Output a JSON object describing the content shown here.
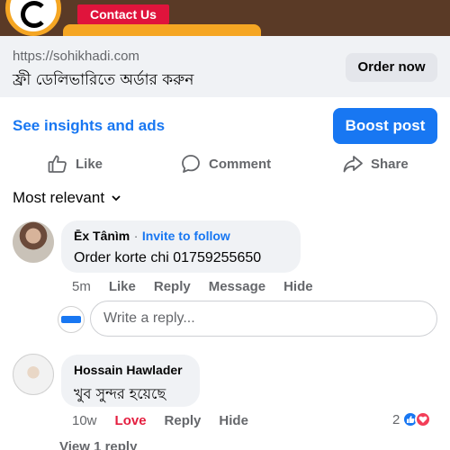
{
  "banner": {
    "contact_label": "Contact Us"
  },
  "link_card": {
    "url": "https://sohikhadi.com",
    "headline": "ফ্রী ডেলিভারিতে অর্ডার করুন",
    "cta_label": "Order now"
  },
  "post_actions": {
    "insights_label": "See insights and ads",
    "boost_label": "Boost post",
    "like_label": "Like",
    "comment_label": "Comment",
    "share_label": "Share"
  },
  "sort": {
    "label": "Most relevant"
  },
  "comments": [
    {
      "author": "Ēx Tânìm",
      "separator": "·",
      "follow_label": "Invite to follow",
      "text": "Order korte  chi  01759255650",
      "time": "5m",
      "actions": [
        "Like",
        "Reply",
        "Message",
        "Hide"
      ]
    },
    {
      "author": "Hossain Hawlader",
      "text": "খুব সুন্দর হয়েছে",
      "time": "10w",
      "actions": [
        "Love",
        "Reply",
        "Hide"
      ],
      "reaction_count": "2",
      "view_replies": "View 1 reply"
    }
  ],
  "reply_box": {
    "placeholder": "Write a reply..."
  },
  "colors": {
    "accent": "#1877f2",
    "love": "#e41e3f",
    "muted": "#65676b"
  }
}
